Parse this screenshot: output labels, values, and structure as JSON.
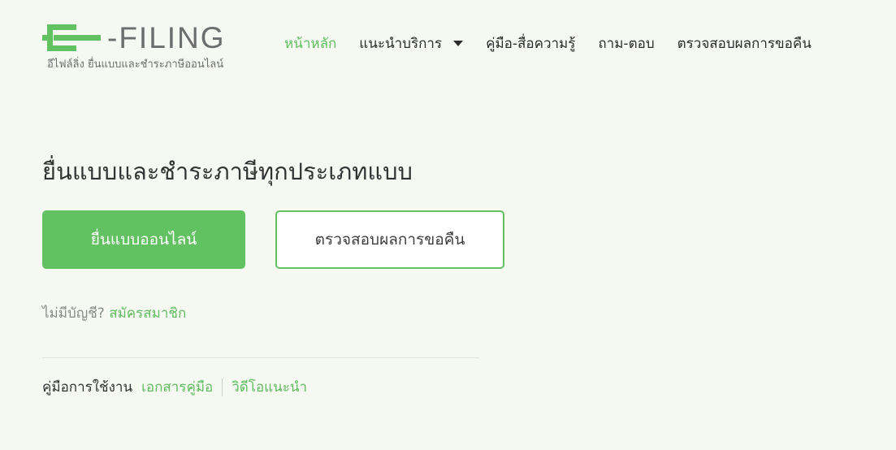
{
  "logo": {
    "title": "-FILING",
    "subtitle": "อีไฟล์ลิ่ง ยื่นแบบและชำระภาษีออนไลน์",
    "icon": "e-letter-logo-icon"
  },
  "nav": {
    "items": [
      {
        "label": "หน้าหลัก",
        "active": true
      },
      {
        "label": "แนะนำบริการ",
        "dropdown": true
      },
      {
        "label": "คู่มือ-สื่อความรู้"
      },
      {
        "label": "ถาม-ตอบ"
      },
      {
        "label": "ตรวจสอบผลการขอคืน"
      }
    ]
  },
  "hero": {
    "headline": "ยื่นแบบและชำระภาษีทุกประเภทแบบ",
    "primary_button": "ยื่นแบบออนไลน์",
    "secondary_button": "ตรวจสอบผลการขอคืน"
  },
  "signup": {
    "prompt": "ไม่มีบัญชี?",
    "link": "สมัครสมาชิก"
  },
  "manual": {
    "label": "คู่มือการใช้งาน",
    "docs_link": "เอกสารคู่มือ",
    "video_link": "วิดีโอแนะนำ"
  },
  "colors": {
    "accent": "#62c262",
    "background": "#f6f9f2",
    "text": "#333333"
  }
}
